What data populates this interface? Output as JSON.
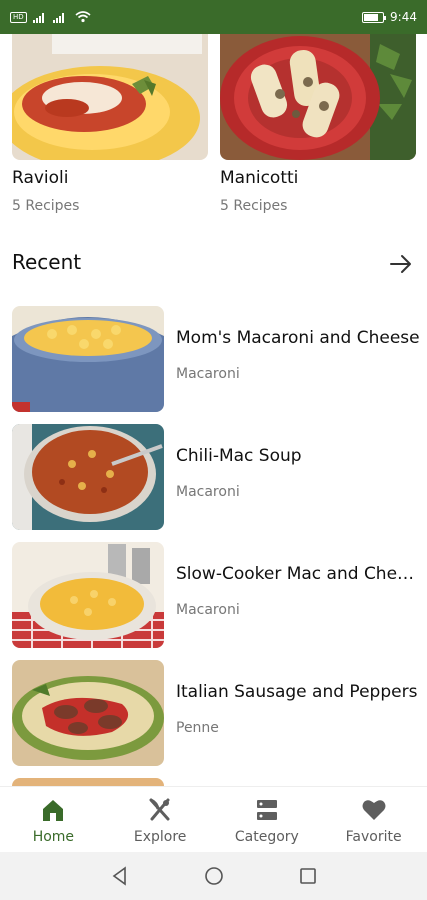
{
  "status_bar": {
    "time": "9:44",
    "left_badge": "HD",
    "battery_level": 0.8
  },
  "categories": [
    {
      "name": "Ravioli",
      "count": "5 Recipes"
    },
    {
      "name": "Manicotti",
      "count": "5 Recipes"
    }
  ],
  "recent": {
    "title": "Recent",
    "items": [
      {
        "title": "Mom's Macaroni and Cheese",
        "category": "Macaroni"
      },
      {
        "title": "Chili-Mac Soup",
        "category": "Macaroni"
      },
      {
        "title": "Slow-Cooker Mac and Cheese",
        "category": "Macaroni"
      },
      {
        "title": "Italian Sausage and Peppers",
        "category": "Penne"
      }
    ]
  },
  "bottom_nav": {
    "items": [
      {
        "label": "Home",
        "icon": "home-icon",
        "active": true
      },
      {
        "label": "Explore",
        "icon": "fork-knife-icon",
        "active": false
      },
      {
        "label": "Category",
        "icon": "category-icon",
        "active": false
      },
      {
        "label": "Favorite",
        "icon": "heart-icon",
        "active": false
      }
    ]
  },
  "colors": {
    "brand": "#3a6b2a",
    "muted_text": "#777777"
  }
}
